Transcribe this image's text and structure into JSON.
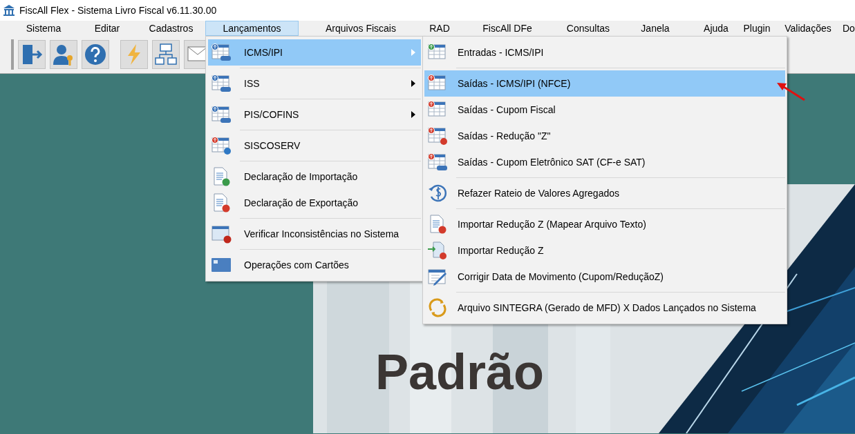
{
  "window": {
    "title": "FiscAll Flex - Sistema Livro Fiscal v6.11.30.00"
  },
  "menu_bar": [
    {
      "label": "Sistema",
      "selected": false
    },
    {
      "label": "Editar",
      "selected": false
    },
    {
      "label": "Cadastros",
      "selected": false
    },
    {
      "label": "Lançamentos",
      "selected": true
    },
    {
      "label": "Arquivos Fiscais",
      "selected": false
    },
    {
      "label": "RAD",
      "selected": false
    },
    {
      "label": "FiscAll DFe",
      "selected": false
    },
    {
      "label": "Consultas",
      "selected": false
    },
    {
      "label": "Janela",
      "selected": false
    },
    {
      "label": "Ajuda",
      "selected": false
    },
    {
      "label": "Plugin",
      "selected": false
    },
    {
      "label": "Validações",
      "selected": false
    },
    {
      "label": "Do",
      "selected": false
    }
  ],
  "menu": {
    "items": [
      {
        "label": "ICMS/IPI",
        "selected": true,
        "has_submenu": true,
        "separator_after": true
      },
      {
        "label": "ISS",
        "selected": false,
        "has_submenu": true,
        "separator_after": true
      },
      {
        "label": "PIS/COFINS",
        "selected": false,
        "has_submenu": true,
        "separator_after": true
      },
      {
        "label": "SISCOSERV",
        "selected": false,
        "has_submenu": false,
        "separator_after": true
      },
      {
        "label": "Declaração de Importação",
        "selected": false,
        "has_submenu": false,
        "separator_after": false
      },
      {
        "label": "Declaração de Exportação",
        "selected": false,
        "has_submenu": false,
        "separator_after": true
      },
      {
        "label": "Verificar Inconsistências no Sistema",
        "selected": false,
        "has_submenu": false,
        "separator_after": true
      },
      {
        "label": "Operações com Cartões",
        "selected": false,
        "has_submenu": false,
        "separator_after": false
      }
    ]
  },
  "submenu": {
    "items": [
      {
        "label": "Entradas - ICMS/IPI",
        "selected": false,
        "separator_after": true
      },
      {
        "label": "Saídas - ICMS/IPI (NFCE)",
        "selected": true,
        "separator_after": false
      },
      {
        "label": "Saídas - Cupom Fiscal",
        "selected": false,
        "separator_after": false
      },
      {
        "label": "Saídas - Redução \"Z\"",
        "selected": false,
        "separator_after": false
      },
      {
        "label": "Saídas - Cupom Eletrônico SAT (CF-e SAT)",
        "selected": false,
        "separator_after": true
      },
      {
        "label": "Refazer Rateio de Valores Agregados",
        "selected": false,
        "separator_after": true
      },
      {
        "label": "Importar Redução Z (Mapear Arquivo Texto)",
        "selected": false,
        "separator_after": false
      },
      {
        "label": "Importar Redução Z",
        "selected": false,
        "separator_after": false
      },
      {
        "label": "Corrigir Data de Movimento (Cupom/ReduçãoZ)",
        "selected": false,
        "separator_after": true
      },
      {
        "label": "Arquivo SINTEGRA (Gerado de MFD) X Dados Lançados no Sistema",
        "selected": false,
        "separator_after": false
      }
    ]
  },
  "banner": {
    "lines": [
      "Padrão"
    ]
  }
}
